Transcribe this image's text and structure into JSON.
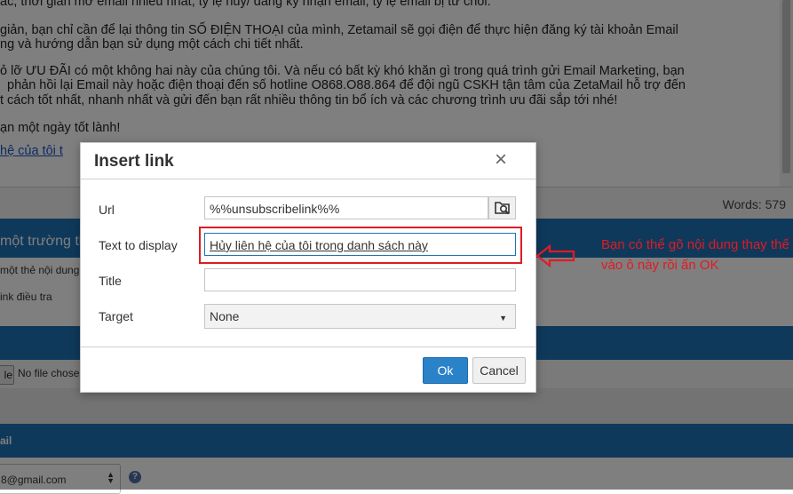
{
  "editor": {
    "lines": [
      "ác, thời gian mở email nhiều nhất, tỷ lệ hủy/ đăng ký nhận email, tỷ lệ email bị từ chối.",
      "giản, bạn chỉ cần để lại thông tin SỐ ĐIỆN THOẠI của mình, Zetamail sẽ gọi điện để thực hiện đăng ký tài khoản Email",
      "ng và hướng dẫn bạn sử dụng một cách chi tiết nhất.",
      "ỏ lỡ ƯU ĐÃI có một không hai này của chúng tôi. Và nếu có bất kỳ khó khăn gì trong quá trình gửi Email Marketing, bạn",
      "phản hồi lại Email này hoặc điện thoại đến số hotline O868.O88.864 để đội ngũ CSKH tận tâm của ZetaMail hỗ trợ đến",
      "t cách tốt nhất, nhanh nhất và gửi đến bạn rất nhiều thông tin bổ ích và các chương trình ưu đãi sắp tới nhé!",
      "ạn một ngày tốt lành!",
      "hệ của tôi t"
    ],
    "word_count": "Words: 579"
  },
  "background": {
    "section1_label": "một trường th",
    "row1": "một thẻ nội dung",
    "row2": "ink điều tra",
    "file_button": "le",
    "file_status": "No file chose",
    "section3_label": "ail",
    "email_value": "8@gmail.com",
    "help_icon_text": "?"
  },
  "dialog": {
    "title": "Insert link",
    "close_label": "×",
    "url_label": "Url",
    "url_value": "%%unsubscribelink%%",
    "text_label": "Text to display",
    "text_value": "Hủy liên hệ của tôi trong danh sách này",
    "title_label": "Title",
    "title_value": "",
    "target_label": "Target",
    "target_value": "None",
    "ok_label": "Ok",
    "cancel_label": "Cancel"
  },
  "annotation": {
    "text": "Bạn có thể gõ nội dung thay thế vào ô này rồi ấn OK",
    "color": "#e01b24"
  },
  "icons": {
    "browse": "folder-search-icon",
    "close": "close-icon",
    "dropdown": "caret-down-icon",
    "help": "help-icon",
    "arrow": "left-arrow-icon"
  }
}
